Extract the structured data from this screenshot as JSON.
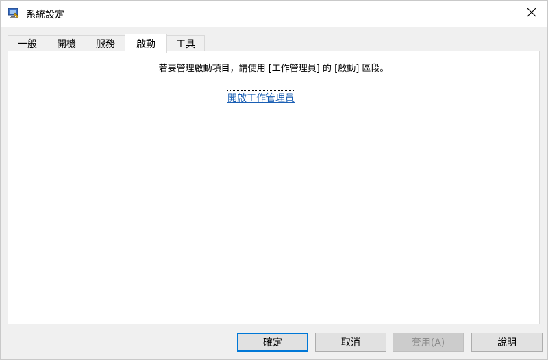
{
  "window": {
    "title": "系統設定"
  },
  "tabs": [
    {
      "label": "一般",
      "active": false
    },
    {
      "label": "開機",
      "active": false
    },
    {
      "label": "服務",
      "active": false
    },
    {
      "label": "啟動",
      "active": true
    },
    {
      "label": "工具",
      "active": false
    }
  ],
  "startup": {
    "instruction": "若要管理啟動項目，請使用 [工作管理員] 的 [啟動] 區段。",
    "link_label": "開啟工作管理員"
  },
  "buttons": {
    "ok": "確定",
    "cancel": "取消",
    "apply": "套用(A)",
    "help": "說明"
  },
  "icons": {
    "app": "system-config-icon",
    "close": "close-icon"
  },
  "colors": {
    "link": "#1a5fb4",
    "default_button_border": "#0078d7"
  }
}
